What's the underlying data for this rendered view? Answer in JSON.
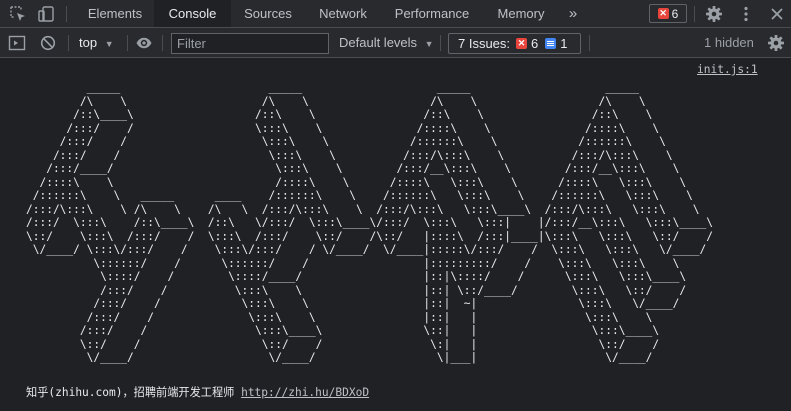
{
  "tabs": [
    {
      "label": "Elements"
    },
    {
      "label": "Console",
      "active": true
    },
    {
      "label": "Sources"
    },
    {
      "label": "Network"
    },
    {
      "label": "Performance"
    },
    {
      "label": "Memory"
    }
  ],
  "more_tabs_glyph": "»",
  "error_badge": {
    "count": "6"
  },
  "toolbar": {
    "context": "top",
    "filter_placeholder": "Filter",
    "levels": "Default levels",
    "issues": {
      "label": "7 Issues:",
      "errors": "6",
      "info": "1"
    },
    "hidden": "1 hidden"
  },
  "console": {
    "source": "init.js:1",
    "ascii_art": "         _____                      _____                    _____                    _____\n        /\\    \\                    /\\    \\                  /\\    \\                  /\\    \\\n       /::\\____\\                  /::\\    \\                /::\\    \\                /::\\    \\\n      /:::/    /                  \\:::\\    \\              /::::\\    \\              /::::\\    \\\n     /:::/    /                    \\:::\\    \\            /::::::\\    \\            /::::::\\    \\\n    /:::/    /                      \\:::\\    \\          /:::/\\:::\\    \\          /:::/\\:::\\    \\\n   /:::/____/                        \\:::\\    \\        /:::/__\\:::\\    \\        /:::/__\\:::\\    \\\n  /::::\\    \\                        /::::\\    \\      /::::\\   \\:::\\    \\      /::::\\   \\:::\\    \\\n /::::::\\    \\   _____      ____    /::::::\\    \\    /::::::\\   \\:::\\    \\    /::::::\\   \\:::\\    \\\n/:::/\\:::\\    \\ /\\    \\    /\\   \\  /:::/\\:::\\    \\  /:::/\\:::\\   \\:::\\____\\  /:::/\\:::\\   \\:::\\    \\\n/:::/  \\:::\\    /::\\____\\  /::\\   \\/:::/  \\:::\\____\\/:::/  \\:::\\   \\:::|    |/:::/__\\:::\\   \\:::\\____\\\n\\::/    \\:::\\  /:::/    /  \\:::\\  /:::/    \\::/    /\\::/   |::::\\  /:::|____|\\:::\\   \\:::\\   \\::/    /\n \\/____/ \\:::\\/:::/    /    \\:::\\/:::/    / \\/____/  \\/____|:::::\\/:::/    /  \\:::\\   \\:::\\   \\/____/\n          \\::::::/    /      \\::::::/    /                 |:::::::::/    /    \\:::\\   \\:::\\    \\\n           \\::::/    /        \\::::/____/                  |::|\\::::/    /      \\:::\\   \\:::\\____\\\n           /:::/    /          \\:::\\    \\                  |::| \\::/____/        \\:::\\   \\::/    /\n          /:::/    /            \\:::\\    \\                 |::|  ~|               \\:::\\   \\/____/\n         /:::/    /              \\:::\\    \\                |::|   |                \\:::\\    \\\n        /:::/    /                \\:::\\____\\               \\::|   |                 \\:::\\____\\\n        \\::/    /                  \\::/    /                \\:|   |                  \\::/    /\n         \\/____/                    \\/____/                  \\|___|                   \\/____/",
    "recruit_text": "知乎(zhihu.com)，招聘前端开发工程师 ",
    "recruit_link": "http://zhi.hu/BDXoD"
  },
  "colors": {
    "background": "#202124",
    "toolbar": "#292a2d",
    "error_red": "#e8453c",
    "info_blue": "#4285f4"
  }
}
